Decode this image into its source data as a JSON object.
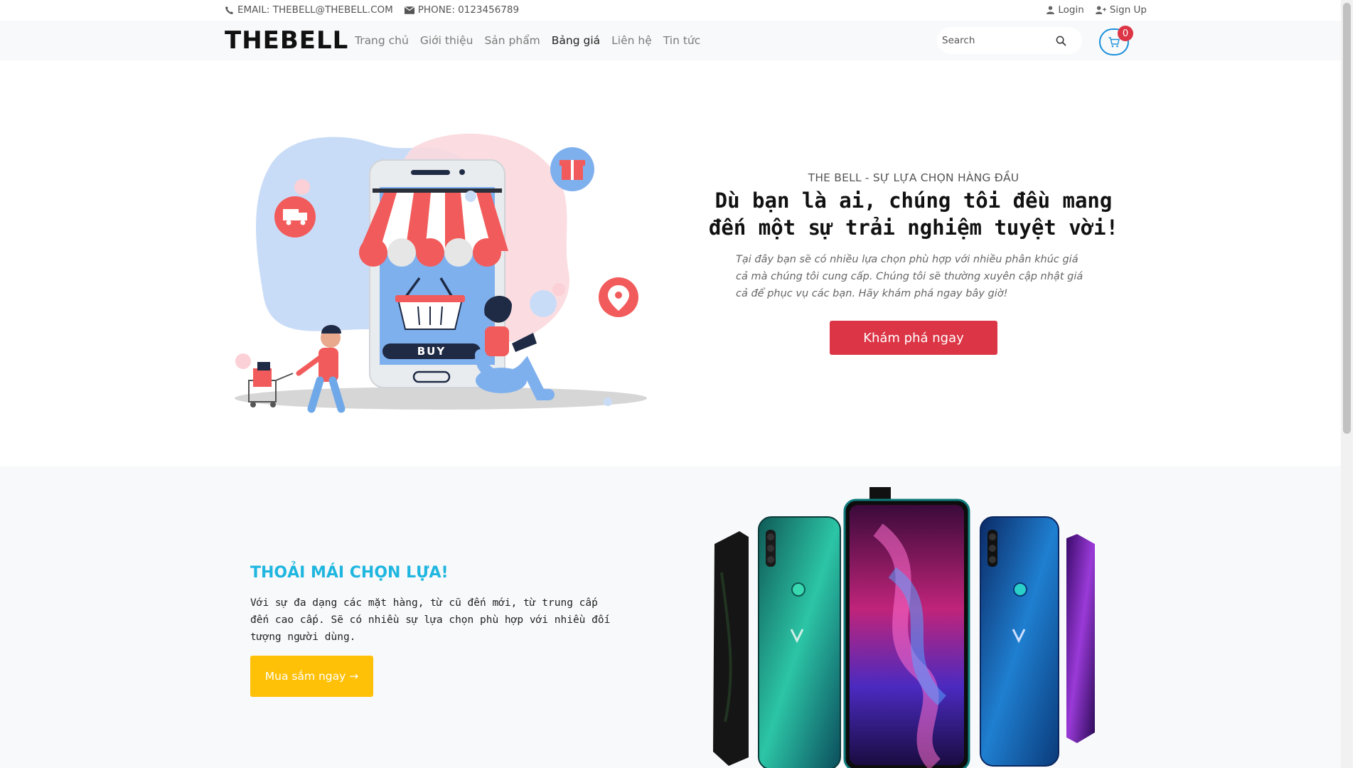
{
  "topbar": {
    "email": "EMAIL: THEBELL@THEBELL.COM",
    "phone": "PHONE: 0123456789",
    "login": "Login",
    "signup": "Sign Up"
  },
  "navbar": {
    "logo": "THEBELL",
    "links": [
      {
        "label": "Trang chủ"
      },
      {
        "label": "Giới thiệu"
      },
      {
        "label": "Sản phẩm"
      },
      {
        "label": "Bảng giá",
        "active": true
      },
      {
        "label": "Liên hệ"
      },
      {
        "label": "Tin tức"
      }
    ],
    "search_placeholder": "Search",
    "cart_count": "0"
  },
  "hero": {
    "kicker": "THE BELL - SỰ LỰA CHỌN HÀNG ĐẦU",
    "title_line1": "Dù bạn là ai, chúng tôi đều mang",
    "title_line2": "đến một sự trải nghiệm tuyệt vời!",
    "description": "Tại đây bạn sẽ có nhiều lựa chọn phù hợp với nhiều phân khúc giá cả mà chúng tôi cung cấp. Chúng tôi sẽ thường xuyên cập nhật giá cả để phục vụ các bạn. Hãy khám phá ngay bây giờ!",
    "button": "Khám phá ngay",
    "illustration_label": "BUY"
  },
  "section2": {
    "title": "THOẢI MÁI CHỌN LỰA!",
    "description": "Với sự đa dạng các mặt hàng, từ cũ đến mới, từ trung cấp đến cao cấp. Sẽ có nhiều sự lựa chọn phù hợp với nhiều đối tượng người dùng.",
    "button": "Mua sắm ngay →"
  },
  "colors": {
    "accent_red": "#dc3545",
    "accent_yellow": "#ffc107",
    "accent_cyan": "#1fb6e0",
    "cart_blue": "#1a8fdb"
  },
  "icons": [
    "phone-icon",
    "mail-icon",
    "user-icon",
    "user-plus-icon",
    "search-icon",
    "cart-icon"
  ]
}
